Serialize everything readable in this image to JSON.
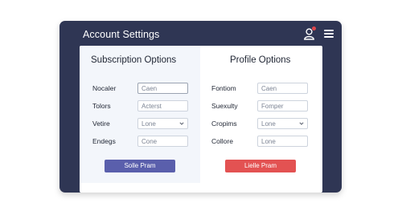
{
  "window": {
    "title": "Account Settings",
    "header_bg": "#2f3654",
    "notification_color": "#e0474c",
    "icons": [
      "user-icon",
      "menu-icon"
    ]
  },
  "subscription": {
    "title": "Subscription Options",
    "rows": [
      {
        "label": "Nocaler",
        "value": "Caen",
        "type": "text"
      },
      {
        "label": "Tolors",
        "value": "Acterst",
        "type": "text"
      },
      {
        "label": "Vetire",
        "value": "Lone",
        "type": "select"
      },
      {
        "label": "Endegs",
        "value": "Cone",
        "type": "text"
      }
    ],
    "button": {
      "label": "Solle Pram",
      "color": "#5a5fac"
    }
  },
  "profile": {
    "title": "Profile Options",
    "rows": [
      {
        "label": "Fontiom",
        "value": "Caen",
        "type": "text"
      },
      {
        "label": "Suexulty",
        "value": "Fomper",
        "type": "text"
      },
      {
        "label": "Cropims",
        "value": "Lone",
        "type": "select"
      },
      {
        "label": "Collore",
        "value": "Lone",
        "type": "text"
      }
    ],
    "button": {
      "label": "Lielle Pram",
      "color": "#e35252"
    }
  }
}
